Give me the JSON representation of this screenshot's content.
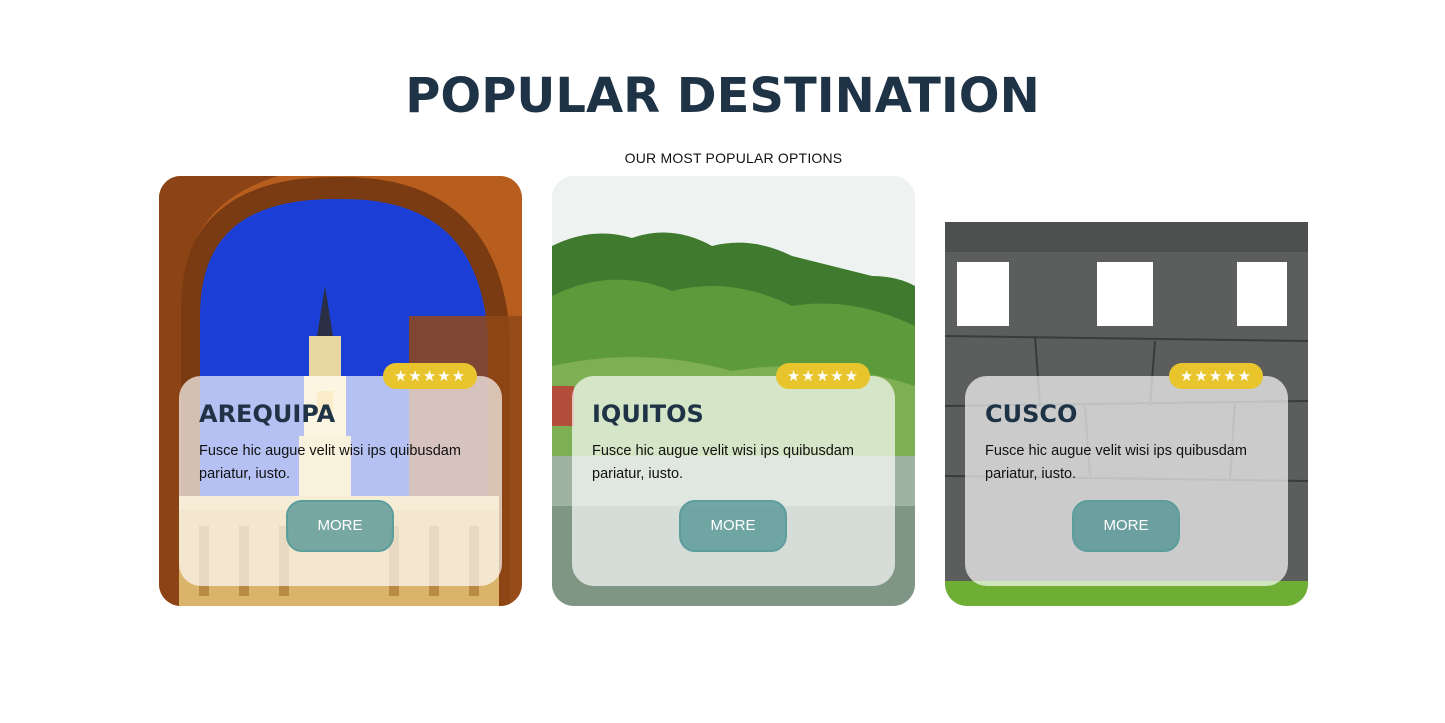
{
  "header": {
    "title": "POPULAR DESTINATION",
    "subtitle": "OUR MOST POPULAR OPTIONS"
  },
  "cards": [
    {
      "name": "AREQUIPA",
      "description": "Fusce hic augue velit wisi ips quibusdam pariatur, iusto.",
      "rating": "★★★★★",
      "button_label": "MORE",
      "image_icon": "arequipa-cathedral-image"
    },
    {
      "name": "IQUITOS",
      "description": "Fusce hic augue velit wisi ips quibusdam pariatur, iusto.",
      "rating": "★★★★★",
      "button_label": "MORE",
      "image_icon": "iquitos-river-image"
    },
    {
      "name": "CUSCO",
      "description": "Fusce hic augue velit wisi ips quibusdam pariatur, iusto.",
      "rating": "★★★★★",
      "button_label": "MORE",
      "image_icon": "cusco-inca-wall-image"
    }
  ],
  "colors": {
    "title": "#1f3346",
    "rating_badge": "#e8c42d",
    "button": "#5d9e9d"
  }
}
